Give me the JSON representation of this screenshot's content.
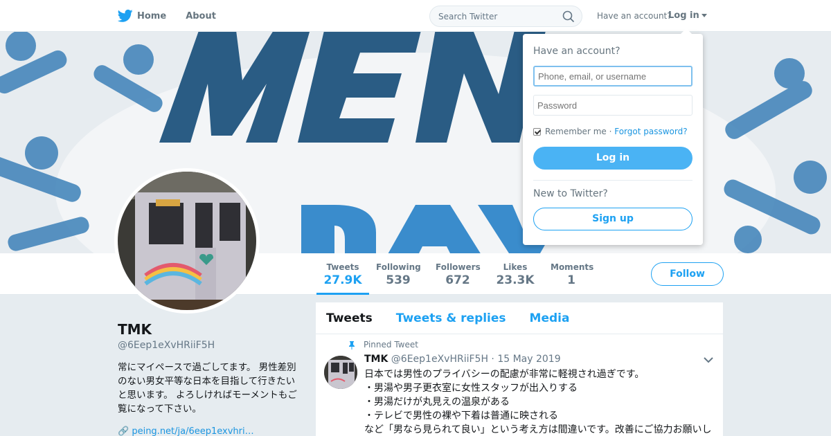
{
  "nav": {
    "home_label": "Home",
    "about_label": "About",
    "search_placeholder": "Search Twitter",
    "have_account": "Have an account?",
    "login_label": "Log in"
  },
  "stats": [
    {
      "label": "Tweets",
      "value": "27.9K"
    },
    {
      "label": "Following",
      "value": "539"
    },
    {
      "label": "Followers",
      "value": "672"
    },
    {
      "label": "Likes",
      "value": "23.3K"
    },
    {
      "label": "Moments",
      "value": "1"
    }
  ],
  "follow_label": "Follow",
  "profile": {
    "name": "TMK",
    "handle": "@6Eep1eXvHRiiF5H",
    "bio": "常にマイペースで過ごしてます。 男性差別のない男女平等な日本を目指して行きたいと思います。 よろしければモーメントもご覧になって下さい。",
    "link": "peing.net/ja/6eep1exvhri…"
  },
  "timeline": {
    "tabs": [
      "Tweets",
      "Tweets & replies",
      "Media"
    ],
    "pinned_label": "Pinned Tweet",
    "tweet": {
      "name": "TMK",
      "handle": "@6Eep1eXvHRiiF5H",
      "date": "· 15 May 2019",
      "text": "日本では男性のプライバシーの配慮が非常に軽視され過ぎです。\n・男湯や男子更衣室に女性スタッフが出入りする\n・男湯だけが丸見えの温泉がある\n・テレビで男性の裸や下着は普通に映される\nなど「男なら見られて良い」という考え方は間違いです。改善にご協力お願いし"
    }
  },
  "login_dropdown": {
    "title": "Have an account?",
    "username_placeholder": "Phone, email, or username",
    "password_placeholder": "Password",
    "remember_label": "Remember me",
    "separator": " · ",
    "forgot_label": "Forgot password?",
    "login_button": "Log in",
    "new_label": "New to Twitter?",
    "signup_button": "Sign up"
  },
  "colors": {
    "accent": "#1da1f2",
    "banner_blue": "#2a6fa8"
  }
}
